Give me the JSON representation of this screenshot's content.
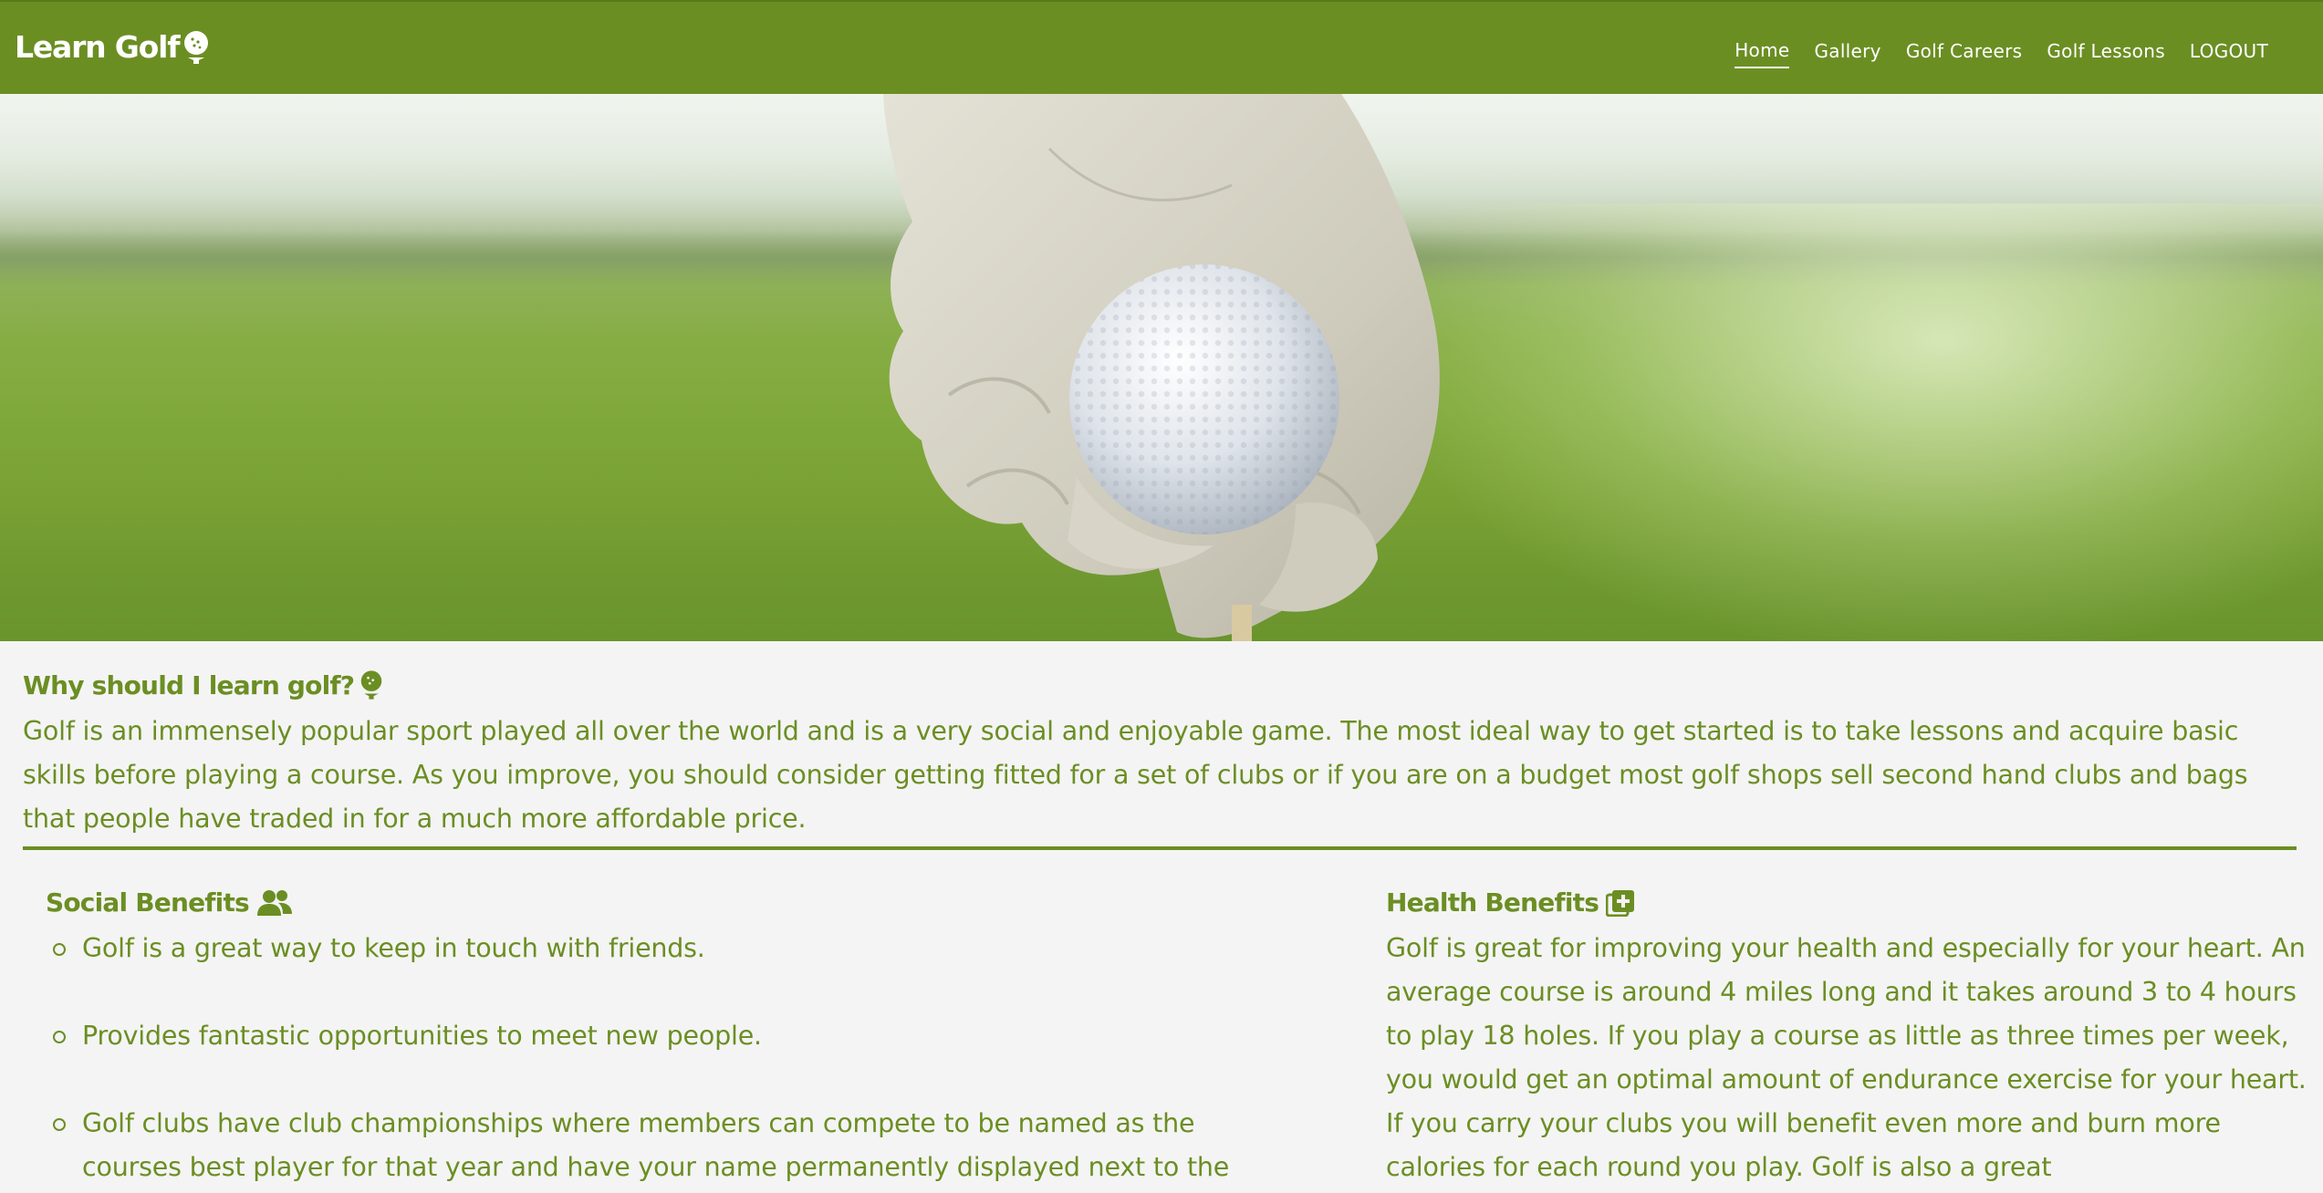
{
  "brand": {
    "name": "Learn Golf",
    "icon": "golf-ball-on-tee-icon",
    "color": "#6b8e23"
  },
  "nav": {
    "items": [
      {
        "label": "Home",
        "active": true
      },
      {
        "label": "Gallery",
        "active": false
      },
      {
        "label": "Golf Careers",
        "active": false
      },
      {
        "label": "Golf Lessons",
        "active": false
      },
      {
        "label": "LOGOUT",
        "active": false
      }
    ]
  },
  "hero": {
    "image": "gloved-hand-placing-golf-ball-on-tee"
  },
  "intro": {
    "heading": "Why should I learn golf?",
    "heading_icon": "golf-ball-on-tee-icon",
    "text": "Golf is an immensely popular sport played all over the world and is a very social and enjoyable game. The most ideal way to get started is to take lessons and acquire basic skills before playing a course. As you improve, you should consider getting fitted for a set of clubs or if you are on a budget most golf shops sell second hand clubs and bags that people have traded in for a much more affordable price."
  },
  "social": {
    "heading": "Social Benefits",
    "heading_icon": "users-icon",
    "items": [
      "Golf is a great way to keep in touch with friends.",
      "Provides fantastic opportunities to meet new people.",
      "Golf clubs have club championships where members can compete to be named as the courses best player for that year and have your name permanently displayed next to the"
    ]
  },
  "health": {
    "heading": "Health Benefits",
    "heading_icon": "medical-plus-icon",
    "text": "Golf is great for improving your health and especially for your heart. An average course is around 4 miles long and it takes around 3 to 4 hours to play 18 holes. If you play a course as little as three times per week, you would get an optimal amount of endurance exercise for your heart. If you carry your clubs you will benefit even more and burn more calories for each round you play. Golf is also a great"
  }
}
